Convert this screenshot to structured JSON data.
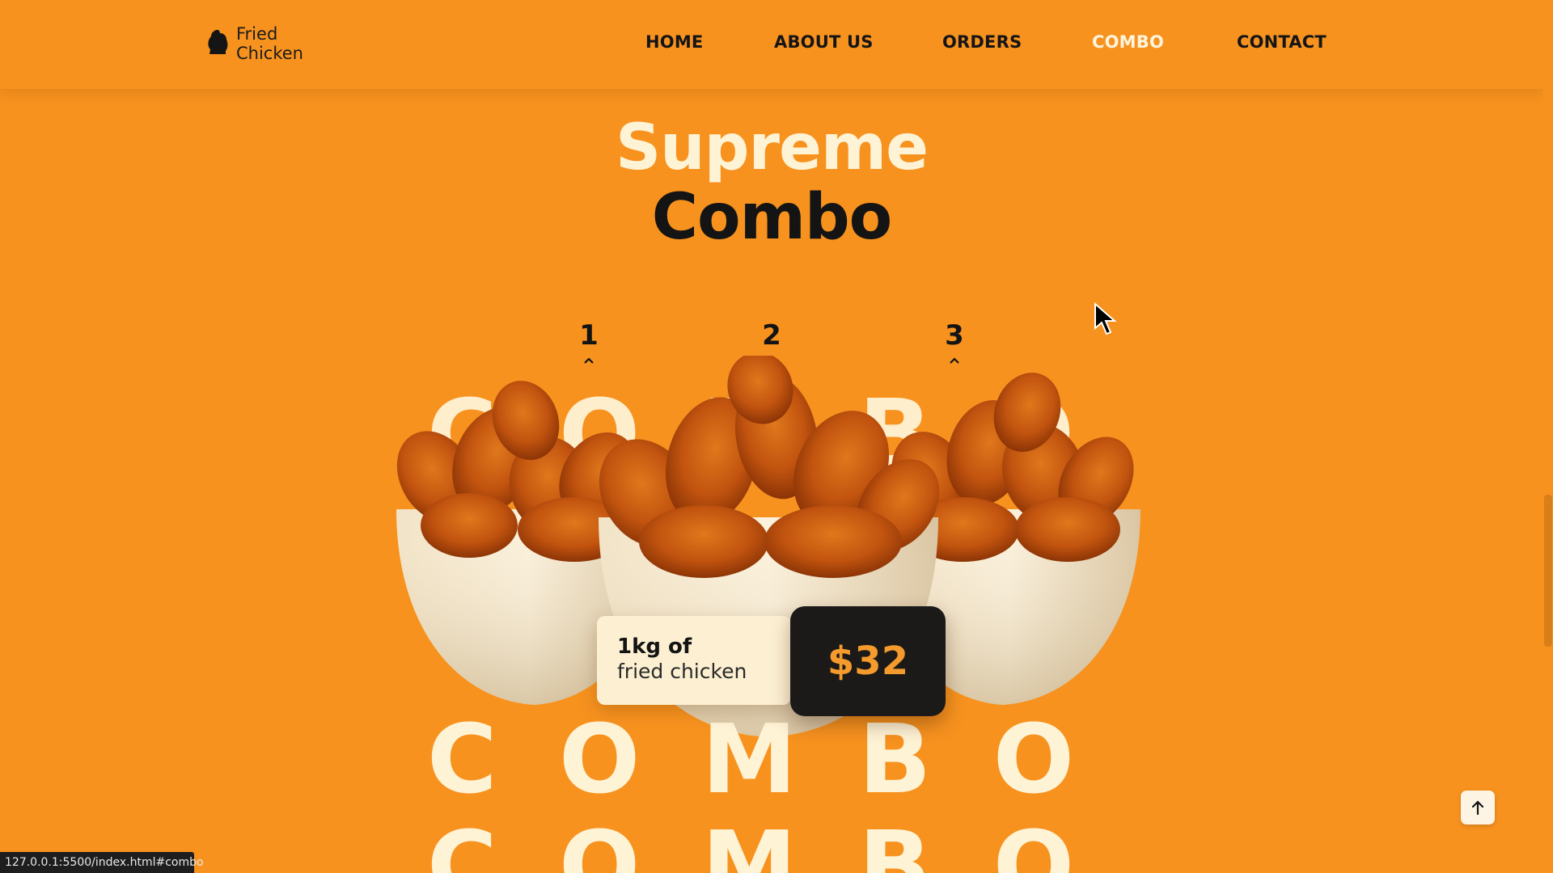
{
  "header": {
    "logo_line1": "Fried",
    "logo_line2": "Chicken",
    "logo_icon": "chicken-icon",
    "nav": [
      {
        "label": "HOME",
        "active": false
      },
      {
        "label": "ABOUT US",
        "active": false
      },
      {
        "label": "ORDERS",
        "active": false
      },
      {
        "label": "COMBO",
        "active": true
      },
      {
        "label": "CONTACT",
        "active": false
      }
    ]
  },
  "hero": {
    "title_line1": "Supreme",
    "title_line2": "Combo"
  },
  "tabs": [
    {
      "label": "1",
      "icon": "caret-up-icon"
    },
    {
      "label": "2",
      "icon": "caret-up-icon"
    },
    {
      "label": "3",
      "icon": "caret-up-icon"
    }
  ],
  "background_text": {
    "letters": [
      "C",
      "O",
      "M",
      "B",
      "O"
    ]
  },
  "product": {
    "line1": "1kg of",
    "line2": "fried chicken",
    "price": "$32"
  },
  "back_to_top_icon": "arrow-up-icon",
  "status_bar": {
    "url": "127.0.0.1:5500/index.html#combo"
  },
  "colors": {
    "background": "#f7921f",
    "cream": "#fff3d6",
    "dark": "#141414",
    "price_accent": "#f59a2c"
  }
}
